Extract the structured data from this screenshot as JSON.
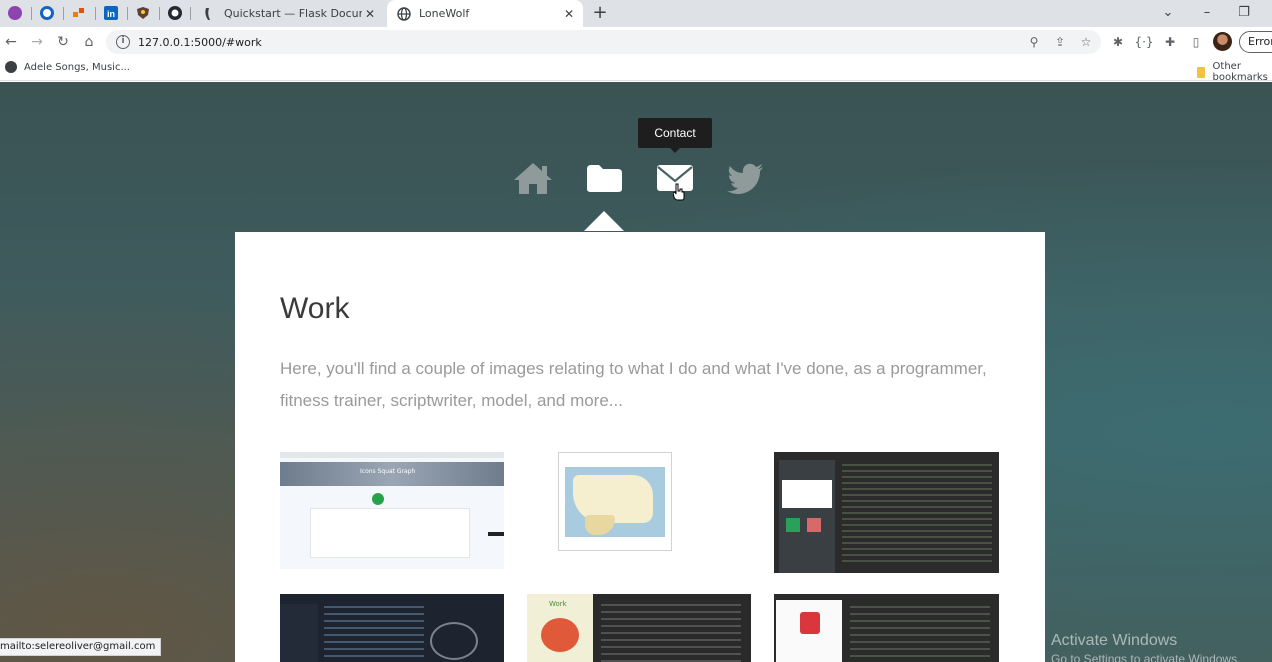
{
  "browser": {
    "tabs": [
      {
        "title": "Quickstart — Flask Documentation",
        "active": false
      },
      {
        "title": "LoneWolf",
        "active": true
      }
    ],
    "new_tab": "+",
    "address": "127.0.0.1:5000/#work",
    "profile_error": "Error",
    "bookmarks": [
      {
        "label": "Adele Songs, Music..."
      }
    ],
    "other_bookmarks": "Other bookmarks"
  },
  "site": {
    "nav": [
      {
        "name": "home",
        "icon": "home-icon"
      },
      {
        "name": "work",
        "icon": "folder-icon"
      },
      {
        "name": "contact",
        "icon": "envelope-icon"
      },
      {
        "name": "twitter",
        "icon": "twitter-icon"
      }
    ],
    "tooltip": "Contact",
    "section": {
      "title": "Work",
      "description": "Here, you'll find a couple of images relating to what I do and what I've done, as a programmer, fitness trainer, scriptwriter, model, and more..."
    },
    "thumb_labels": {
      "squat_graph": "Icons Squat Graph",
      "pomodoro": "Work"
    }
  },
  "status_bar": {
    "link": "mailto:selereoliver@gmail.com"
  },
  "watermark": {
    "line1": "Activate Windows",
    "line2": "Go to Settings to activate Windows."
  },
  "colors": {
    "tab_strip": "#dee1e6",
    "tooltip_bg": "#1e1e1e",
    "panel_bg": "#ffffff",
    "backdrop": "#3f5c5e"
  }
}
